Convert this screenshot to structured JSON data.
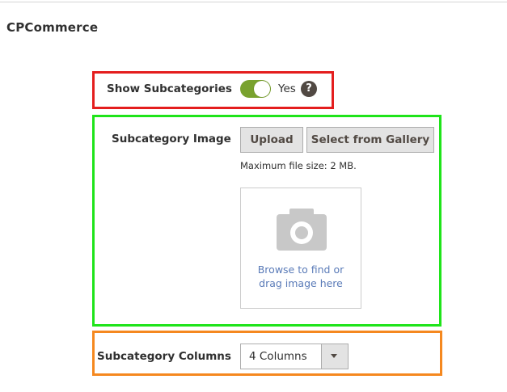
{
  "section": {
    "title": "CPCommerce"
  },
  "show_subcategories": {
    "label": "Show Subcategories",
    "toggle_state_text": "Yes",
    "help_glyph": "?",
    "toggle_on": true,
    "toggle_color": "#79a22e"
  },
  "subcategory_image": {
    "label": "Subcategory Image",
    "upload_label": "Upload",
    "gallery_label": "Select from Gallery",
    "max_size_note": "Maximum file size: 2 MB.",
    "dropzone_line1": "Browse to find or",
    "dropzone_line2": "drag image here",
    "dropzone_icon": "camera-icon"
  },
  "subcategory_columns": {
    "label": "Subcategory Columns",
    "selected": "4 Columns"
  },
  "annotations": {
    "red": "#e41e1e",
    "green": "#1fe41a",
    "orange": "#f5881f"
  }
}
